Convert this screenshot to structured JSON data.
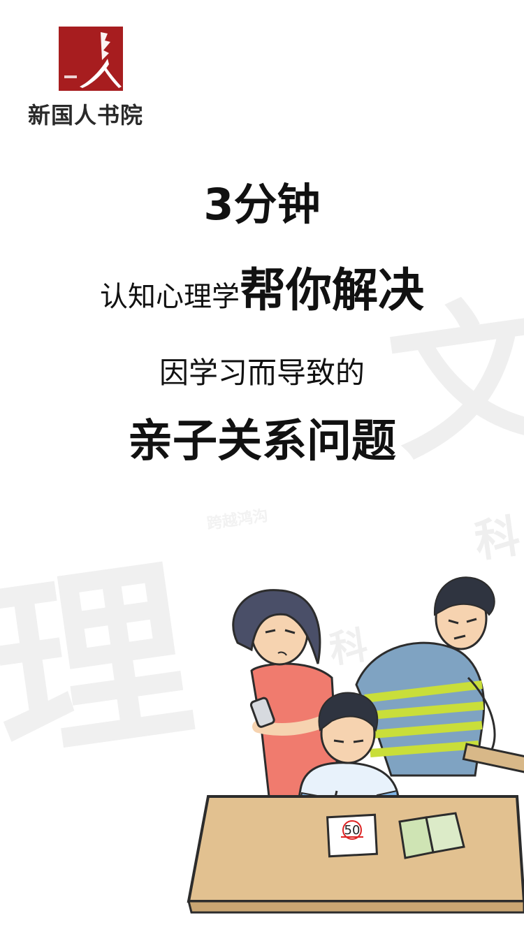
{
  "brand": {
    "name": "新国人书院",
    "logo_text": "新国人书院",
    "accent_color": "#a71d1f"
  },
  "headline": {
    "line1": "3分钟",
    "line2_prefix": "认知心理学",
    "line2_emphasis": "帮你解决",
    "line3": "因学习而导致的",
    "line4": "亲子关系问题"
  },
  "illustration": {
    "paper_text": "50",
    "icon": "family-homework-illustration"
  },
  "watermark": {
    "char1": "文",
    "char2": "科",
    "char3": "理",
    "char4": "科",
    "line": "跨越鸿沟"
  }
}
